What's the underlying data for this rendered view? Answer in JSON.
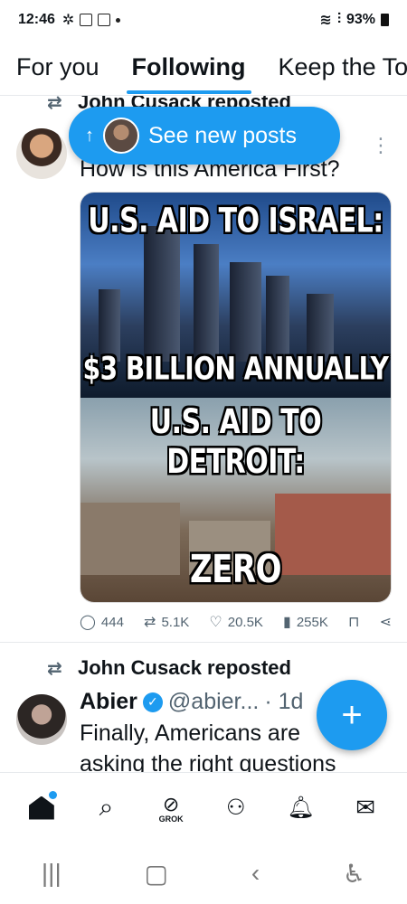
{
  "status_bar": {
    "time": "12:46",
    "battery": "93%"
  },
  "tabs": [
    {
      "label": "For you"
    },
    {
      "label": "Following"
    },
    {
      "label": "Keep the To"
    }
  ],
  "new_posts_pill": {
    "label": "See new posts"
  },
  "post1": {
    "repost_label": "John Cusack reposted",
    "text": "How is this America First?",
    "meme": {
      "top_caption": "U.S. AID TO ISRAEL:",
      "top_amount": "$3 BILLION ANNUALLY",
      "bottom_caption": "U.S. AID TO DETROIT:",
      "bottom_amount": "ZERO"
    },
    "stats": {
      "replies": "444",
      "reposts": "5.1K",
      "likes": "20.5K",
      "views": "255K"
    }
  },
  "post2": {
    "repost_label": "John Cusack reposted",
    "name": "Abier",
    "handle": "@abier...",
    "time": "· 1d",
    "text_line1": "Finally, Americans are",
    "text_line2": "asking the right questions"
  },
  "bottom_nav": {
    "grok_label": "GROK"
  },
  "colors": {
    "accent": "#1d9bf0",
    "text": "#0f1419",
    "muted": "#536471"
  }
}
